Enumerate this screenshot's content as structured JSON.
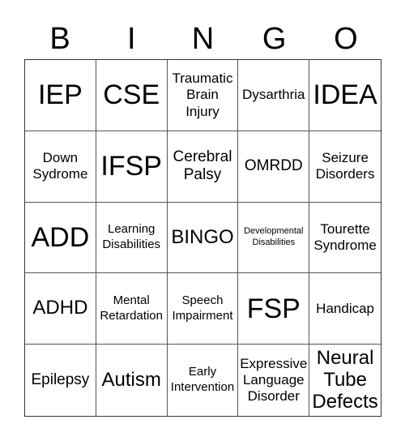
{
  "header": {
    "letters": [
      "B",
      "I",
      "N",
      "G",
      "O"
    ]
  },
  "cells": [
    "IEP",
    "CSE",
    "Traumatic Brain Injury",
    "Dysarthria",
    "IDEA",
    "Down Sydrome",
    "IFSP",
    "Cerebral Palsy",
    "OMRDD",
    "Seizure Disorders",
    "ADD",
    "Learning Disabilities",
    "BINGO",
    "Developmental Disabilities",
    "Tourette Syndrome",
    "ADHD",
    "Mental Retardation",
    "Speech Impairment",
    "FSP",
    "Handicap",
    "Epilepsy",
    "Autism",
    "Early Intervention",
    "Expressive Language Disorder",
    "Neural Tube Defects"
  ]
}
